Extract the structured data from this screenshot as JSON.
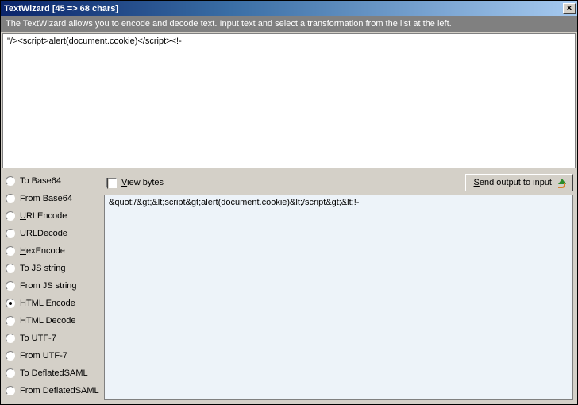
{
  "title": "TextWizard [45 => 68 chars]",
  "description": "The TextWizard allows you to encode and decode text. Input text and select a transformation from the list at the left.",
  "input_text": "\"/><script>alert(document.cookie)</script><!-",
  "view_bytes_label": "View bytes",
  "send_button": "Send output to input",
  "output_text": "&quot;/&gt;&lt;script&gt;alert(document.cookie)&lt;/script&gt;&lt;!-",
  "transforms": [
    {
      "label": "To Base64",
      "accel": "",
      "checked": false
    },
    {
      "label": "From Base64",
      "accel": "",
      "checked": false
    },
    {
      "label": "URLEncode",
      "accel": "U",
      "checked": false
    },
    {
      "label": "URLDecode",
      "accel": "U",
      "checked": false
    },
    {
      "label": "HexEncode",
      "accel": "H",
      "checked": false
    },
    {
      "label": "To JS string",
      "accel": "",
      "checked": false
    },
    {
      "label": "From JS string",
      "accel": "",
      "checked": false
    },
    {
      "label": "HTML Encode",
      "accel": "",
      "checked": true
    },
    {
      "label": "HTML Decode",
      "accel": "",
      "checked": false
    },
    {
      "label": "To UTF-7",
      "accel": "",
      "checked": false
    },
    {
      "label": "From UTF-7",
      "accel": "",
      "checked": false
    },
    {
      "label": "To DeflatedSAML",
      "accel": "",
      "checked": false
    },
    {
      "label": "From DeflatedSAML",
      "accel": "",
      "checked": false
    }
  ]
}
